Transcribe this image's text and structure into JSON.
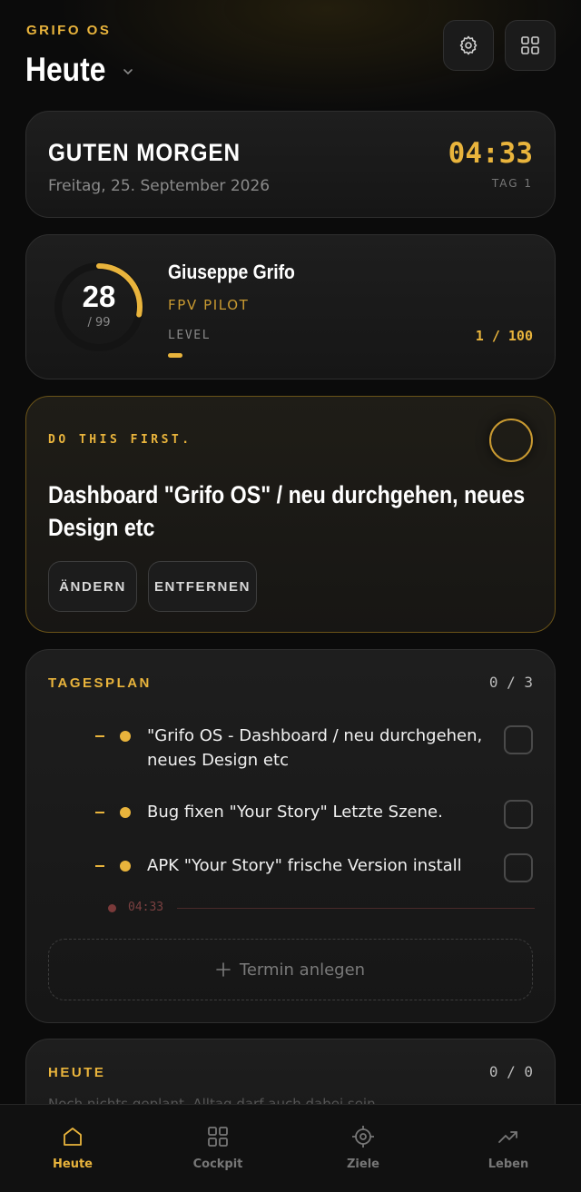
{
  "header": {
    "brand": "GRIFO OS",
    "title": "Heute",
    "settings_icon": "gear-icon",
    "grid_icon": "grid-icon"
  },
  "greeting": {
    "text": "GUTEN MORGEN",
    "date": "Freitag, 25. September 2026",
    "time": "04:33",
    "day": "TAG 1"
  },
  "profile": {
    "level_value": "28",
    "level_max": "/ 99",
    "ring_fraction": 0.28,
    "name": "Giuseppe Grifo",
    "role": "FPV PILOT",
    "level_label": "LEVEL",
    "xp_text": "1 / 100",
    "xp_fraction": 0.01
  },
  "focus": {
    "label": "DO THIS FIRST.",
    "task": "Dashboard \"Grifo OS\" / neu durchgehen, neues Design etc",
    "edit_label": "ÄNDERN",
    "remove_label": "ENTFERNEN"
  },
  "plan": {
    "title": "TAGESPLAN",
    "count": "0 / 3",
    "items": [
      {
        "text": "\"Grifo OS - Dashboard / neu durchgehen, neues Design etc"
      },
      {
        "text": "Bug fixen \"Your Story\" Letzte Szene."
      },
      {
        "text": "APK \"Your Story\" frische Version install"
      }
    ],
    "now_time": "04:33",
    "add_label": "Termin anlegen"
  },
  "today": {
    "title": "HEUTE",
    "count": "0 / 0",
    "empty_text": "Noch nichts geplant. Alltag darf auch dabei sein."
  },
  "nav": {
    "items": [
      {
        "label": "Heute",
        "icon": "home-icon",
        "active": true
      },
      {
        "label": "Cockpit",
        "icon": "grid-icon",
        "active": false
      },
      {
        "label": "Ziele",
        "icon": "target-icon",
        "active": false
      },
      {
        "label": "Leben",
        "icon": "trend-icon",
        "active": false
      }
    ]
  },
  "colors": {
    "accent": "#e9b43c",
    "background": "#0b0b0b",
    "card": "#1a1a1a"
  }
}
